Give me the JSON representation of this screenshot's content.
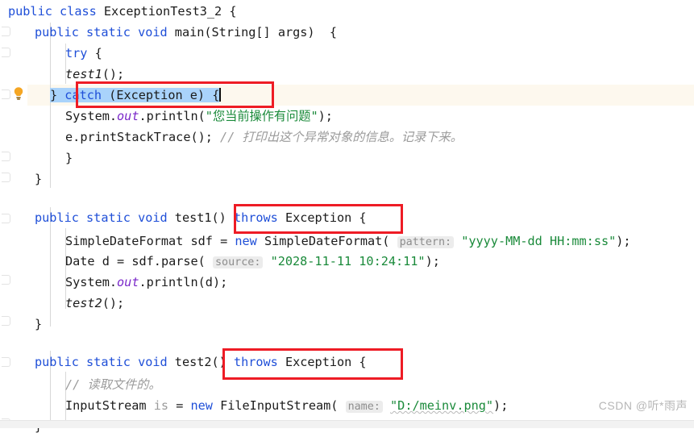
{
  "app": {
    "kind": "java-code-editor",
    "file_class": "ExceptionTest3_2"
  },
  "colors": {
    "background": "#ffffff",
    "keyword": "#1f4fd8",
    "string": "#1a8a3a",
    "comment": "#9b9b9b",
    "field": "#7a28c9",
    "selection": "#a9d3fb",
    "highlight_line": "#fdf8ee",
    "annotation_box": "#ee1c25",
    "bulb": "#f5a623",
    "watermark": "#b6b6b6"
  },
  "gutter": {
    "bulb_icon": "lightbulb-icon",
    "fold_icon": "code-fold-marker-icon",
    "bulb_line": 5,
    "fold_lines": [
      2,
      3,
      5,
      8,
      9,
      11,
      14,
      17,
      20,
      21
    ]
  },
  "code": {
    "lines": [
      {
        "n": 1,
        "indent": 0,
        "text": "public class ExceptionTest3_2 {"
      },
      {
        "n": 2,
        "indent": 1,
        "text": "public static void main(String[] args)  {"
      },
      {
        "n": 3,
        "indent": 2,
        "text": "try {"
      },
      {
        "n": 4,
        "indent": 3,
        "text": "test1();"
      },
      {
        "n": 5,
        "indent": 2,
        "text": "} catch (Exception e) {"
      },
      {
        "n": 6,
        "indent": 3,
        "text": "System.out.println(\"您当前操作有问题\");"
      },
      {
        "n": 7,
        "indent": 3,
        "text": "e.printStackTrace(); // 打印出这个异常对象的信息。记录下来。"
      },
      {
        "n": 8,
        "indent": 2,
        "text": "}"
      },
      {
        "n": 9,
        "indent": 1,
        "text": "}"
      },
      {
        "n": 10,
        "indent": 0,
        "text": ""
      },
      {
        "n": 11,
        "indent": 1,
        "text": "public static void test1() throws Exception {"
      },
      {
        "n": 12,
        "indent": 2,
        "text": "SimpleDateFormat sdf = new SimpleDateFormat( pattern: \"yyyy-MM-dd HH:mm:ss\");"
      },
      {
        "n": 13,
        "indent": 2,
        "text": "Date d = sdf.parse( source: \"2028-11-11 10:24:11\");"
      },
      {
        "n": 14,
        "indent": 2,
        "text": "System.out.println(d);"
      },
      {
        "n": 15,
        "indent": 2,
        "text": "test2();"
      },
      {
        "n": 16,
        "indent": 1,
        "text": "}"
      },
      {
        "n": 17,
        "indent": 0,
        "text": ""
      },
      {
        "n": 18,
        "indent": 1,
        "text": "public static void test2() throws Exception {"
      },
      {
        "n": 19,
        "indent": 2,
        "text": "// 读取文件的。"
      },
      {
        "n": 20,
        "indent": 2,
        "text": "InputStream is = new FileInputStream( name: \"D:/meinv.png\");"
      },
      {
        "n": 21,
        "indent": 1,
        "text": "}"
      }
    ],
    "tokens": {
      "kw_public": "public",
      "kw_class": "class",
      "kw_static": "static",
      "kw_void": "void",
      "kw_try": "try",
      "kw_catch": "catch",
      "kw_new": "new",
      "kw_throws": "throws",
      "class_name": "ExceptionTest3_2",
      "main": "main",
      "string_args": "String[] args",
      "exception_type": "Exception",
      "exception_var": "e",
      "method_test1": "test1",
      "method_test2": "test2",
      "system": "System",
      "out_field": "out",
      "println": "println",
      "print_stack_trace": "printStackTrace",
      "simple_date_format": "SimpleDateFormat",
      "sdf_var": "sdf",
      "date_type": "Date",
      "date_var": "d",
      "parse": "parse",
      "input_stream": "InputStream",
      "is_var": "is",
      "file_input_stream": "FileInputStream"
    },
    "strings": {
      "println_message": "\"您当前操作有问题\"",
      "date_pattern": "\"yyyy-MM-dd HH:mm:ss\"",
      "date_source": "\"2028-11-11 10:24:11\"",
      "file_path": "\"D:/meinv.png\""
    },
    "comments": {
      "stack_trace": "// 打印出这个异常对象的信息。记录下来。",
      "read_file": "// 读取文件的。"
    },
    "param_hints": {
      "pattern": "pattern:",
      "source": "source:",
      "name": "name:"
    }
  },
  "annotations": {
    "boxes": [
      {
        "id": "catch-clause-box",
        "label": "catch (Exception e) {"
      },
      {
        "id": "test1-throws-box",
        "label": "throws Exception {"
      },
      {
        "id": "test2-throws-box",
        "label": "throws Exception {"
      }
    ]
  },
  "watermark": {
    "text": "CSDN @听*雨声"
  }
}
